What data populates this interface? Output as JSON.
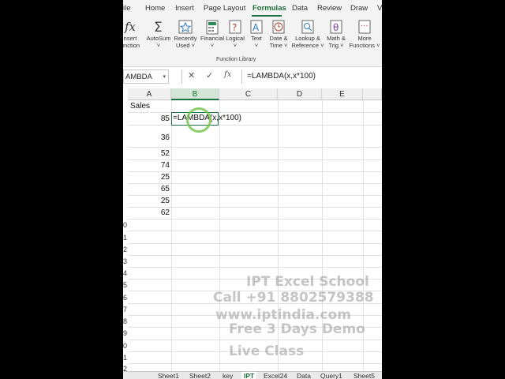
{
  "ribbon": {
    "tabs": [
      "ile",
      "Home",
      "Insert",
      "Page Layout",
      "Formulas",
      "Data",
      "Review",
      "Draw",
      "V"
    ],
    "active_tab": "Formulas",
    "buttons": [
      {
        "label1": "nsert",
        "label2": "unction",
        "icon": "fx-icon"
      },
      {
        "label1": "AutoSum",
        "label2": "˅",
        "icon": "sigma-icon"
      },
      {
        "label1": "Recently",
        "label2": "Used ˅",
        "icon": "star-icon"
      },
      {
        "label1": "Financial",
        "label2": "˅",
        "icon": "financial-icon"
      },
      {
        "label1": "Logical",
        "label2": "˅",
        "icon": "logical-icon"
      },
      {
        "label1": "Text",
        "label2": "˅",
        "icon": "text-icon"
      },
      {
        "label1": "Date &",
        "label2": "Time ˅",
        "icon": "clock-icon"
      },
      {
        "label1": "Lookup &",
        "label2": "Reference ˅",
        "icon": "lookup-icon"
      },
      {
        "label1": "Math &",
        "label2": "Trig ˅",
        "icon": "theta-icon"
      },
      {
        "label1": "More",
        "label2": "Functions ˅",
        "icon": "more-icon"
      }
    ],
    "group_label": "Function Library"
  },
  "formula_bar": {
    "name_box": "AMBDA",
    "cancel_icon": "✕",
    "enter_icon": "✓",
    "fx_icon": "fx",
    "formula": "=LAMBDA(x,x*100)"
  },
  "grid": {
    "columns": [
      "A",
      "B",
      "C",
      "D",
      "E"
    ],
    "selected_column": "B",
    "header_text": "Sales",
    "values": [
      "85",
      "36",
      "52",
      "74",
      "25",
      "65",
      "25",
      "62"
    ],
    "edit_text": "=LAMBDA(x,x*100)",
    "row_fragments": [
      "0",
      "1",
      "2",
      "3",
      "4",
      "5",
      "6",
      "7",
      "8",
      "9",
      "0",
      "1",
      "2"
    ]
  },
  "watermark": {
    "line1": "IPT Excel School",
    "line2": "Call +91 8802579388",
    "line3": "www.iptindia.com",
    "line4": "Free 3 Days Demo",
    "line5": "Live Class"
  },
  "sheets": {
    "tabs": [
      "Sheet1",
      "Sheet2",
      "key",
      "IPT",
      "Excel24",
      "Data",
      "Query1",
      "Sheet5"
    ],
    "active": "IPT"
  },
  "colors": {
    "accent": "#1e7145",
    "accent_light": "#d3e5d6"
  }
}
